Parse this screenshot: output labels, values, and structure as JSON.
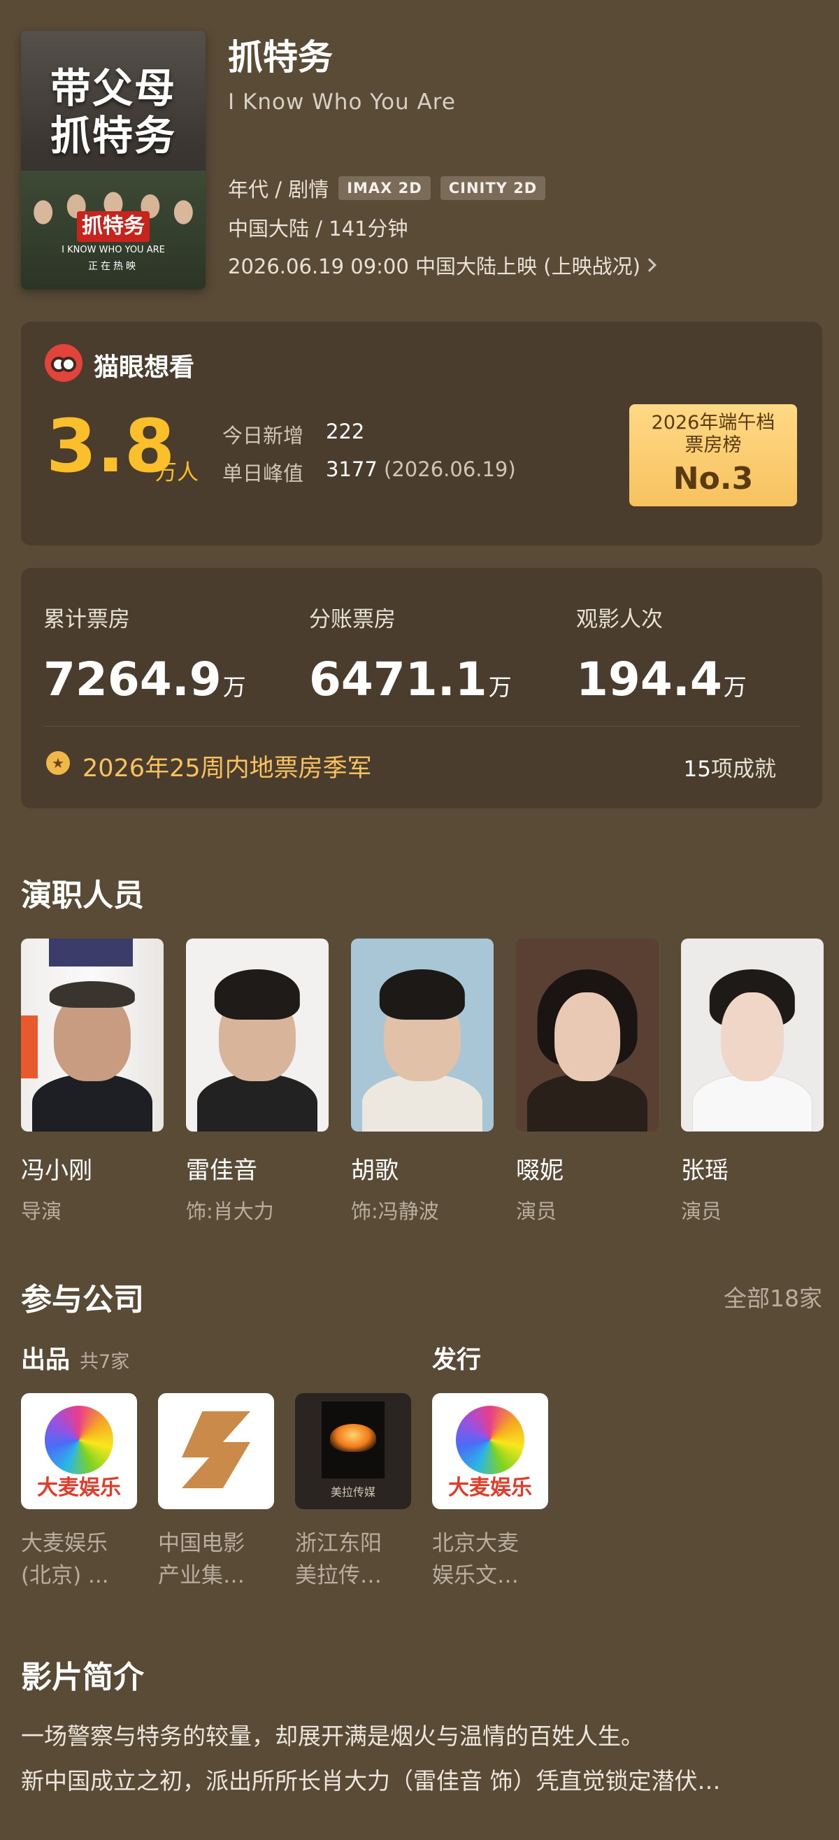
{
  "poster": {
    "title_line1": "带父母",
    "title_line2": "抓特务",
    "logo_text": "抓特务",
    "subtitle_en": "I KNOW WHO YOU ARE",
    "status": "正在热映"
  },
  "movie": {
    "title": "抓特务",
    "title_en": "I Know Who You Are",
    "genre": "年代 / 剧情",
    "formats": [
      "IMAX 2D",
      "CINITY 2D"
    ],
    "region_duration": "中国大陆 / 141分钟",
    "release": "2026.06.19 09:00 中国大陆上映 (上映战况)"
  },
  "want": {
    "label": "猫眼想看",
    "number": "3.8",
    "unit": "万人",
    "today_label": "今日新增",
    "today_value": "222",
    "peak_label": "单日峰值",
    "peak_value": "3177",
    "peak_date": "(2026.06.19)",
    "rank_line1": "2026年端午档",
    "rank_line2": "票房榜",
    "rank_value": "No.3"
  },
  "box_office": {
    "stats": [
      {
        "label": "累计票房",
        "value": "7264.9",
        "unit": "万"
      },
      {
        "label": "分账票房",
        "value": "6471.1",
        "unit": "万"
      },
      {
        "label": "观影人次",
        "value": "194.4",
        "unit": "万"
      }
    ],
    "achievement": "2026年25周内地票房季军",
    "achievement_count": "15",
    "achievement_count_label": "项成就"
  },
  "cast": {
    "title": "演职人员",
    "members": [
      {
        "name": "冯小刚",
        "role": "导演"
      },
      {
        "name": "雷佳音",
        "role": "饰:肖大力"
      },
      {
        "name": "胡歌",
        "role": "饰:冯静波"
      },
      {
        "name": "啜妮",
        "role": "演员"
      },
      {
        "name": "张瑶",
        "role": "演员"
      }
    ]
  },
  "companies": {
    "title": "参与公司",
    "all_label": "全部18家",
    "producer_label": "出品",
    "producer_count": "共7家",
    "distributor_label": "发行",
    "items": [
      {
        "name1": "大麦娱乐",
        "name2": "(北京) ...",
        "logo_text": "大麦娱乐"
      },
      {
        "name1": "中国电影",
        "name2": "产业集…",
        "logo_text": ""
      },
      {
        "name1": "浙江东阳",
        "name2": "美拉传…",
        "logo_text": "美拉传媒"
      },
      {
        "name1": "北京大麦",
        "name2": "娱乐文…",
        "logo_text": "大麦娱乐"
      }
    ]
  },
  "intro": {
    "title": "影片简介",
    "line1": "一场警察与特务的较量，却展开满是烟火与温情的百姓人生。",
    "line2": "新中国成立之初，派出所所长肖大力（雷佳音 饰）凭直觉锁定潜伏…"
  },
  "colors": {
    "background": "#5a4b37",
    "card": "#4a3d2d",
    "accent_yellow": "#fbbf2c",
    "badge_gold": "#f7c25f"
  }
}
